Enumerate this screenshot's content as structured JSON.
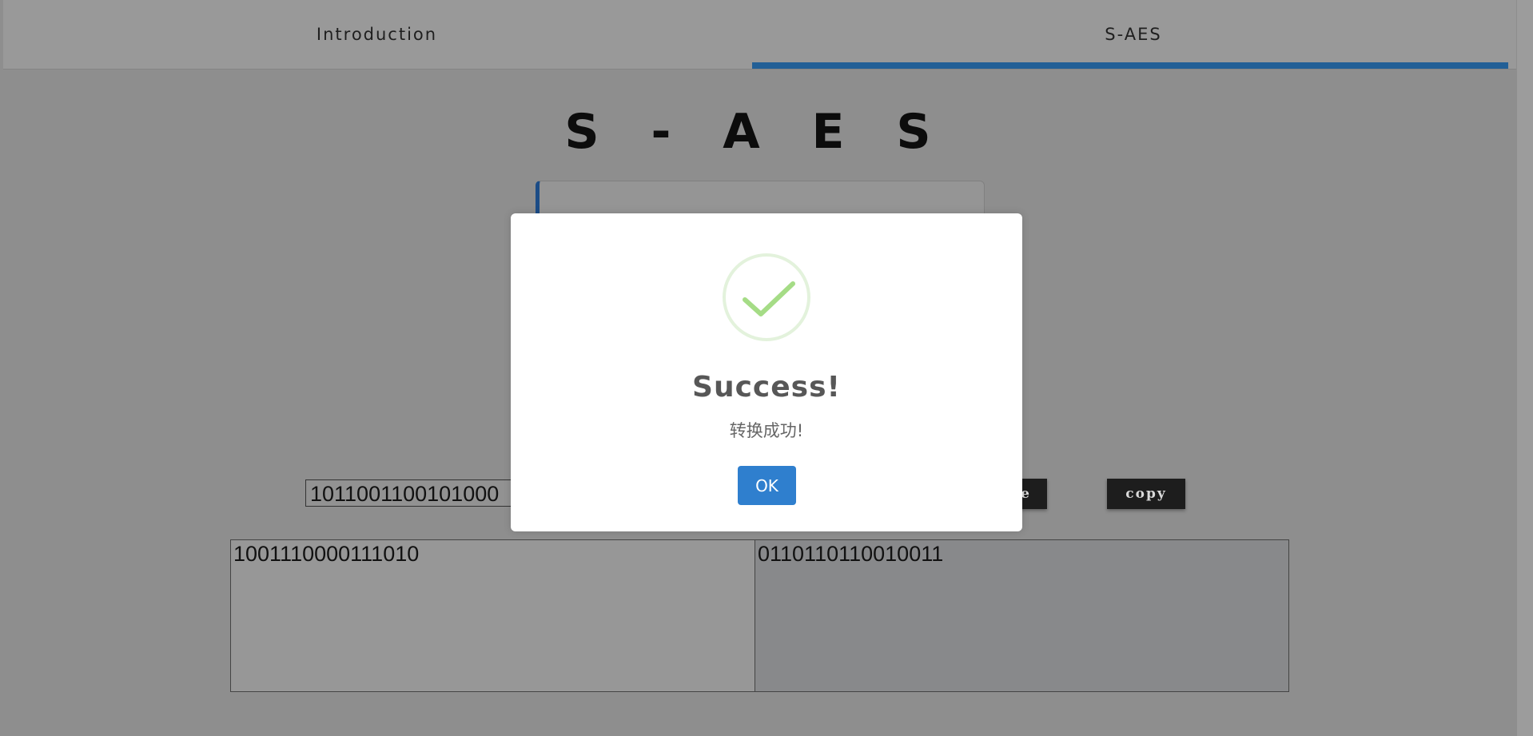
{
  "tabs": [
    {
      "label": "Introduction"
    },
    {
      "label": "S-AES"
    }
  ],
  "page": {
    "title": "S - A E S"
  },
  "controls": {
    "binary_input_value": "1011001100101000",
    "partial_button_label": "e",
    "copy_button_label": "copy"
  },
  "outputs": {
    "left": "1001110000111010",
    "right": "0110110110010011"
  },
  "modal": {
    "icon": "success-check-icon",
    "title": "Success!",
    "message": "转换成功!",
    "ok_label": "OK"
  },
  "colors": {
    "overlay_bg": "#8e8e8e",
    "tab_active_underline": "#225f96",
    "ok_button": "#2f7fce",
    "success_check": "#a5dc86",
    "success_ring": "#e3f2dc"
  }
}
